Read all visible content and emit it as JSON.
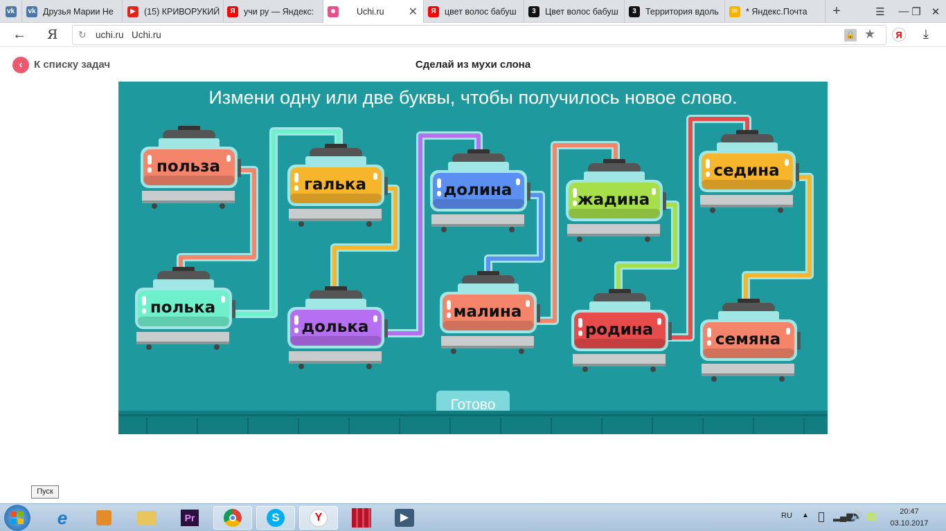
{
  "browser": {
    "tabs": [
      {
        "title": "Друзья Марии Не",
        "icon": "vk-icon",
        "color": "#4a76a8",
        "glyph": "vk"
      },
      {
        "title": "(15) КРИВОРУКИЙ",
        "icon": "youtube-icon",
        "color": "#e62117",
        "glyph": "▶"
      },
      {
        "title": "учи ру — Яндекс:",
        "icon": "yandex-icon",
        "color": "#ff0000",
        "glyph": "Я"
      },
      {
        "title": "Uchi.ru",
        "icon": "uchi-icon",
        "color": "#e94f8a",
        "glyph": "☻",
        "active": true
      },
      {
        "title": "цвет волос бабуш",
        "icon": "yandex-icon",
        "color": "#ff0000",
        "glyph": "Я"
      },
      {
        "title": "Цвет волос бабуш",
        "icon": "zen-icon",
        "color": "#111111",
        "glyph": "3"
      },
      {
        "title": "Территория вдоль",
        "icon": "zen-icon",
        "color": "#111111",
        "glyph": "3"
      },
      {
        "title": "* Яндекс.Почта",
        "icon": "mail-icon",
        "color": "#f4b400",
        "glyph": "✉"
      }
    ],
    "new_tab": "+",
    "url_domain": "uchi.ru",
    "url_title": "Uchi.ru",
    "yandex_logo": "Я"
  },
  "page": {
    "back_label": "К списку задач",
    "title": "Сделай из мухи слона",
    "instruction": "Измени одну или две буквы, чтобы получилось новое слово.",
    "ready_label": "Готово"
  },
  "jars": [
    {
      "word": "польза",
      "color": "#f4856b"
    },
    {
      "word": "полька",
      "color": "#6ff0cc"
    },
    {
      "word": "галька",
      "color": "#f7b52b"
    },
    {
      "word": "долька",
      "color": "#b56ff0"
    },
    {
      "word": "долина",
      "color": "#5b8ff2"
    },
    {
      "word": "малина",
      "color": "#f4856b"
    },
    {
      "word": "жадина",
      "color": "#a6df49"
    },
    {
      "word": "родина",
      "color": "#e84b4b"
    },
    {
      "word": "седина",
      "color": "#f7b52b"
    },
    {
      "word": "семяна",
      "color": "#f4856b"
    }
  ],
  "taskbar": {
    "start_tooltip": "Пуск",
    "lang": "RU",
    "time": "20:47",
    "date": "03.10.2017"
  }
}
